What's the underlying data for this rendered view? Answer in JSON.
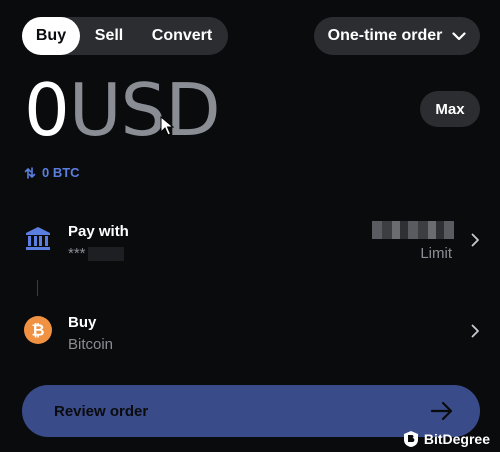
{
  "tabs": [
    {
      "label": "Buy",
      "active": true
    },
    {
      "label": "Sell",
      "active": false
    },
    {
      "label": "Convert",
      "active": false
    }
  ],
  "order_type": {
    "label": "One-time order",
    "icon": "chevron-down-icon"
  },
  "amount": {
    "value": "0",
    "currency": "USD"
  },
  "max_label": "Max",
  "btc_equivalent": "0 BTC",
  "pay_with": {
    "title": "Pay with",
    "masked": "***",
    "limit_label": "Limit",
    "icon": "bank-icon"
  },
  "buy": {
    "title": "Buy",
    "asset": "Bitcoin",
    "icon": "bitcoin-icon",
    "icon_color": "#f09242"
  },
  "review": {
    "label": "Review order",
    "icon": "arrow-right-icon"
  },
  "watermark": {
    "text": "BitDegree"
  },
  "colors": {
    "accent": "#5b7fe0",
    "button": "#3a4b8a",
    "pill": "#2b2d31"
  }
}
